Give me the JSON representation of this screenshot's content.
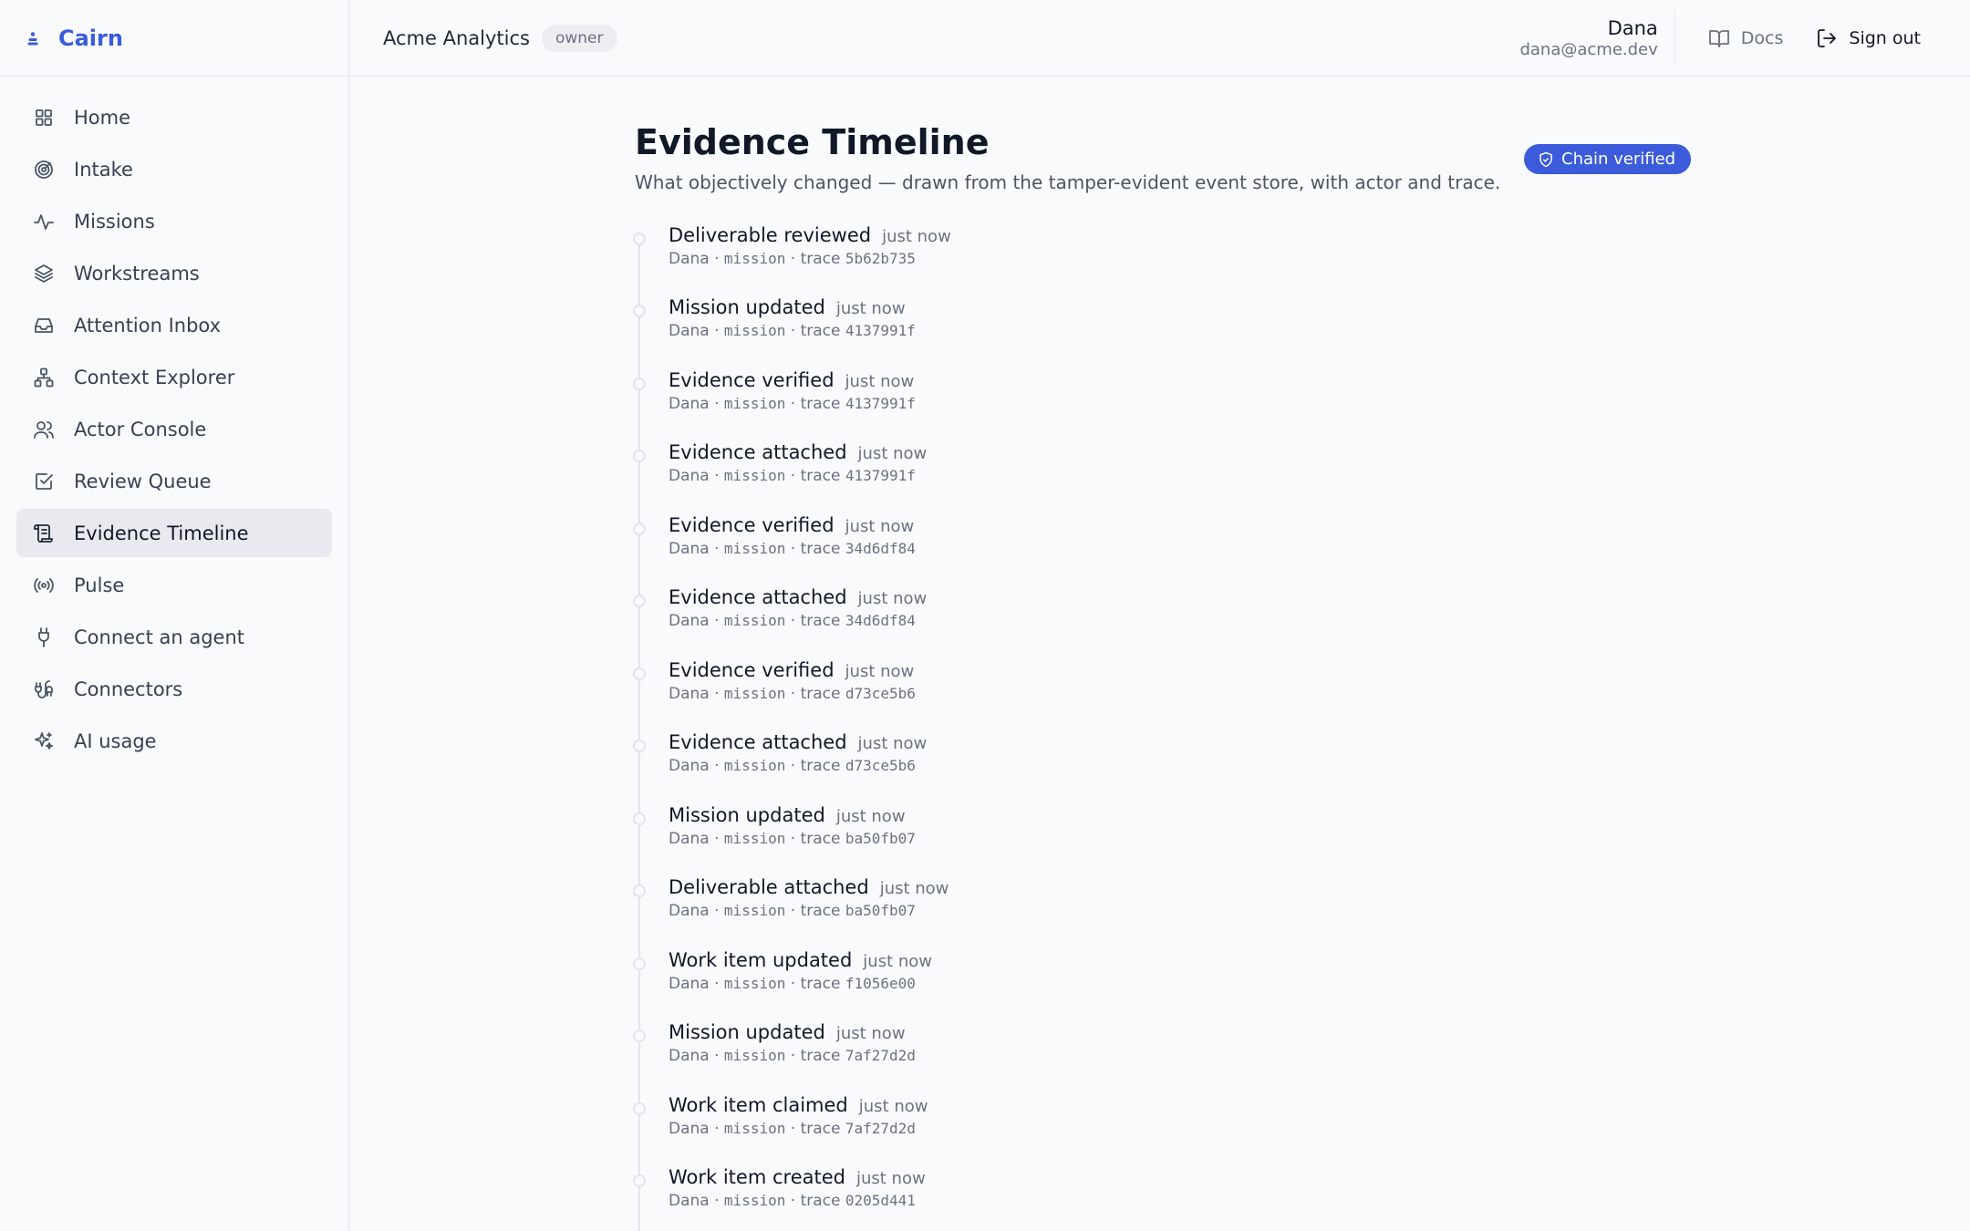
{
  "brand": {
    "name": "Cairn"
  },
  "sidebar": {
    "items": [
      {
        "label": "Home",
        "icon": "grid-icon",
        "active": false
      },
      {
        "label": "Intake",
        "icon": "target-icon",
        "active": false
      },
      {
        "label": "Missions",
        "icon": "activity-icon",
        "active": false
      },
      {
        "label": "Workstreams",
        "icon": "layers-icon",
        "active": false
      },
      {
        "label": "Attention Inbox",
        "icon": "inbox-icon",
        "active": false
      },
      {
        "label": "Context Explorer",
        "icon": "network-icon",
        "active": false
      },
      {
        "label": "Actor Console",
        "icon": "users-icon",
        "active": false
      },
      {
        "label": "Review Queue",
        "icon": "check-square-icon",
        "active": false
      },
      {
        "label": "Evidence Timeline",
        "icon": "scroll-icon",
        "active": true
      },
      {
        "label": "Pulse",
        "icon": "radio-icon",
        "active": false
      },
      {
        "label": "Connect an agent",
        "icon": "plug-icon",
        "active": false
      },
      {
        "label": "Connectors",
        "icon": "cable-icon",
        "active": false
      },
      {
        "label": "AI usage",
        "icon": "sparkles-icon",
        "active": false
      }
    ]
  },
  "header": {
    "org": "Acme Analytics",
    "role": "owner",
    "user_name": "Dana",
    "user_email": "dana@acme.dev",
    "docs_label": "Docs",
    "signout_label": "Sign out"
  },
  "main": {
    "title": "Evidence Timeline",
    "subtitle": "What objectively changed — drawn from the tamper-evident event store, with actor and trace.",
    "chain_badge": "Chain verified",
    "events": [
      {
        "title": "Deliverable reviewed",
        "time": "just now",
        "actor": "Dana",
        "kind": "mission",
        "trace_label": "trace",
        "trace": "5b62b735"
      },
      {
        "title": "Mission updated",
        "time": "just now",
        "actor": "Dana",
        "kind": "mission",
        "trace_label": "trace",
        "trace": "4137991f"
      },
      {
        "title": "Evidence verified",
        "time": "just now",
        "actor": "Dana",
        "kind": "mission",
        "trace_label": "trace",
        "trace": "4137991f"
      },
      {
        "title": "Evidence attached",
        "time": "just now",
        "actor": "Dana",
        "kind": "mission",
        "trace_label": "trace",
        "trace": "4137991f"
      },
      {
        "title": "Evidence verified",
        "time": "just now",
        "actor": "Dana",
        "kind": "mission",
        "trace_label": "trace",
        "trace": "34d6df84"
      },
      {
        "title": "Evidence attached",
        "time": "just now",
        "actor": "Dana",
        "kind": "mission",
        "trace_label": "trace",
        "trace": "34d6df84"
      },
      {
        "title": "Evidence verified",
        "time": "just now",
        "actor": "Dana",
        "kind": "mission",
        "trace_label": "trace",
        "trace": "d73ce5b6"
      },
      {
        "title": "Evidence attached",
        "time": "just now",
        "actor": "Dana",
        "kind": "mission",
        "trace_label": "trace",
        "trace": "d73ce5b6"
      },
      {
        "title": "Mission updated",
        "time": "just now",
        "actor": "Dana",
        "kind": "mission",
        "trace_label": "trace",
        "trace": "ba50fb07"
      },
      {
        "title": "Deliverable attached",
        "time": "just now",
        "actor": "Dana",
        "kind": "mission",
        "trace_label": "trace",
        "trace": "ba50fb07"
      },
      {
        "title": "Work item updated",
        "time": "just now",
        "actor": "Dana",
        "kind": "mission",
        "trace_label": "trace",
        "trace": "f1056e00"
      },
      {
        "title": "Mission updated",
        "time": "just now",
        "actor": "Dana",
        "kind": "mission",
        "trace_label": "trace",
        "trace": "7af27d2d"
      },
      {
        "title": "Work item claimed",
        "time": "just now",
        "actor": "Dana",
        "kind": "mission",
        "trace_label": "trace",
        "trace": "7af27d2d"
      },
      {
        "title": "Work item created",
        "time": "just now",
        "actor": "Dana",
        "kind": "mission",
        "trace_label": "trace",
        "trace": "0205d441"
      }
    ]
  },
  "colors": {
    "accent": "#3b5bdb",
    "active_bg": "#e8eaf0",
    "border": "#e2e6ec"
  }
}
